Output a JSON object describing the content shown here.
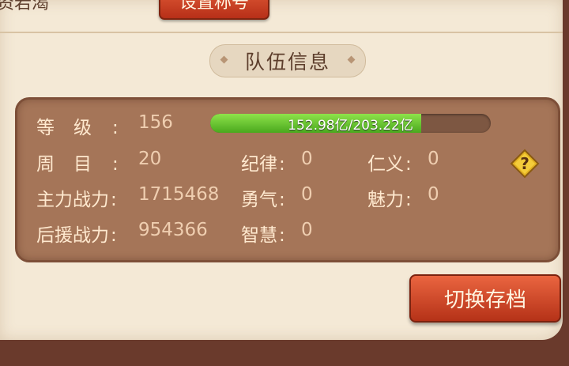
{
  "header": {
    "name_text": "资若渴",
    "set_title_button": "设置称号"
  },
  "section_title": "队伍信息",
  "stats": {
    "level_label": "等级",
    "level_value": "156",
    "exp_text": "152.98亿/203.22亿",
    "exp_progress": 0.753,
    "cycle_label": "周目",
    "cycle_value": "20",
    "discipline_label": "纪律",
    "discipline_value": "0",
    "benevolence_label": "仁义",
    "benevolence_value": "0",
    "main_power_label": "主力战力",
    "main_power_value": "1715468",
    "courage_label": "勇气",
    "courage_value": "0",
    "charm_label": "魅力",
    "charm_value": "0",
    "support_power_label": "后援战力",
    "support_power_value": "954366",
    "wisdom_label": "智慧",
    "wisdom_value": "0",
    "help_icon": "question-mark-icon"
  },
  "switch_save_button": "切换存档",
  "colors": {
    "parchment": "#f4e9d6",
    "panel": "#a57558",
    "button_red": "#c9421f",
    "exp_green": "#6fcf35"
  }
}
